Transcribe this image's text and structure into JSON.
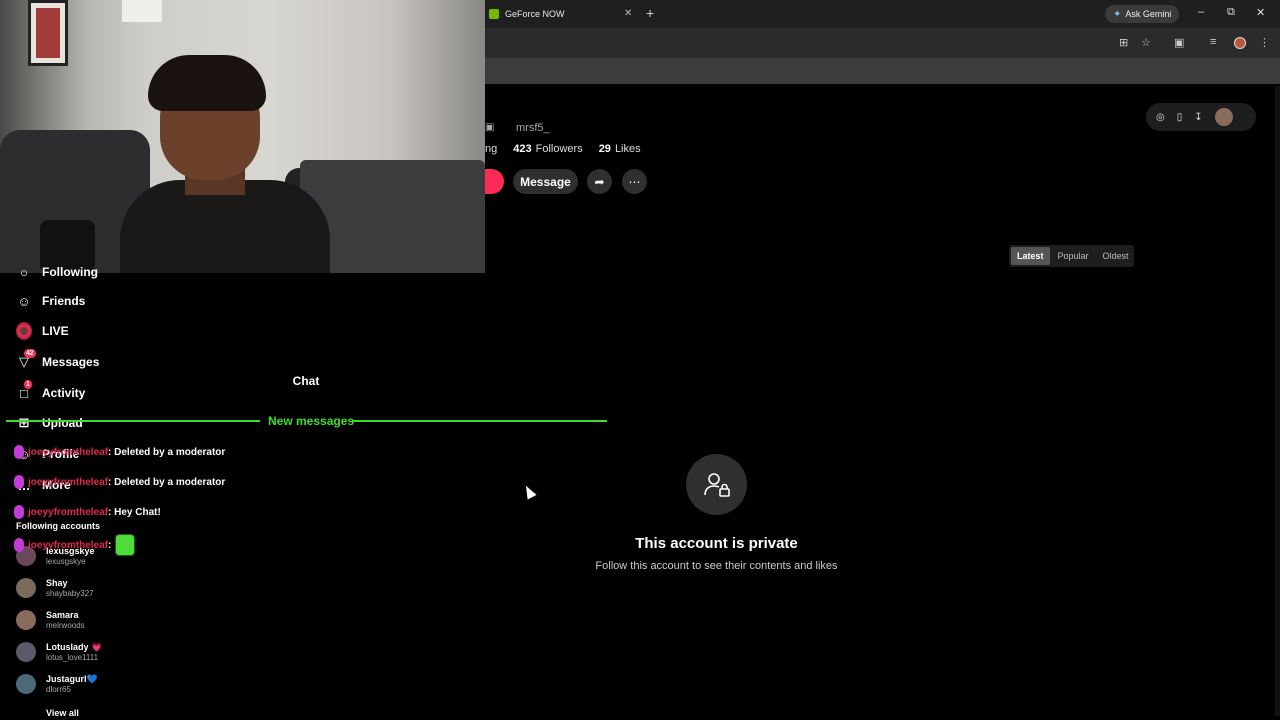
{
  "browser": {
    "tab_title": "GeForce NOW",
    "tab_close_icon": "✕",
    "new_tab_icon": "+",
    "gemini_label": "Ask Gemini",
    "window_minimize": "–",
    "window_restore": "⧉",
    "window_close": "✕"
  },
  "sidebar": {
    "items": [
      {
        "label": "Following",
        "icon": "following-icon",
        "glyph": "○"
      },
      {
        "label": "Friends",
        "icon": "friends-icon",
        "glyph": "☺"
      },
      {
        "label": "LIVE",
        "icon": "live-icon",
        "glyph": ""
      },
      {
        "label": "Messages",
        "icon": "messages-icon",
        "glyph": "▽",
        "badge": "42"
      },
      {
        "label": "Activity",
        "icon": "activity-icon",
        "glyph": "□",
        "badge": "1"
      },
      {
        "label": "Upload",
        "icon": "upload-icon",
        "glyph": "⊞"
      },
      {
        "label": "Profile",
        "icon": "profile-icon",
        "glyph": "☺"
      },
      {
        "label": "More",
        "icon": "more-icon",
        "glyph": "…"
      }
    ],
    "following_title": "Following accounts",
    "following": [
      {
        "name": "lexusgskye",
        "handle": "lexusgskye"
      },
      {
        "name": "Shay",
        "handle": "shaybaby327"
      },
      {
        "name": "Samara",
        "handle": "melrwoods"
      },
      {
        "name": "Lotuslady",
        "handle": "lotus_love1111",
        "emoji": "💗"
      },
      {
        "name": "Justagurl",
        "handle": "dlorr65",
        "emoji": "💙"
      }
    ],
    "view_all": "View all"
  },
  "chat": {
    "title": "Chat",
    "new_messages": "New messages",
    "messages": [
      {
        "user": "joeyyfromtheleaf",
        "text": ": Deleted by a moderator"
      },
      {
        "user": "joeyyfromtheleaf",
        "text": ": Deleted by a moderator"
      },
      {
        "user": "joeyyfromtheleaf",
        "text": ": Hey Chat!"
      },
      {
        "user": "joeyyfromtheleaf",
        "text": ":",
        "emote": true
      }
    ]
  },
  "profile": {
    "username": "mrsf5_",
    "following_fragment": "ng",
    "followers_count": "423",
    "followers_label": "Followers",
    "likes_count": "29",
    "likes_label": "Likes",
    "message_label": "Message",
    "share_icon": "➦",
    "more_icon": "⋯",
    "lock_icon": "🔒",
    "sort_tabs": [
      "Latest",
      "Popular",
      "Oldest"
    ],
    "sort_active": "Latest",
    "private_title": "This account is private",
    "private_subtitle": "Follow this account to see their contents and likes"
  },
  "colors": {
    "accent": "#fe2c55",
    "chat_highlight": "#3cdc2a",
    "chat_username": "#e0294f",
    "nvidia_green": "#76b900"
  }
}
